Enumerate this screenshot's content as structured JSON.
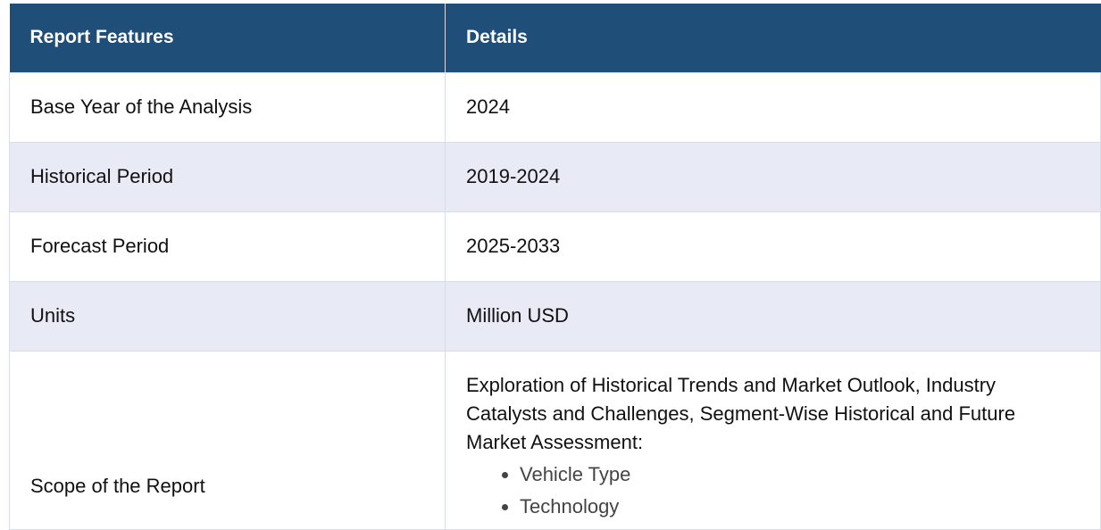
{
  "table": {
    "headers": [
      "Report Features",
      "Details"
    ],
    "rows": [
      {
        "feature": "Base Year of the Analysis",
        "detail": "2024"
      },
      {
        "feature": "Historical Period",
        "detail": "2019-2024"
      },
      {
        "feature": "Forecast Period",
        "detail": "2025-2033"
      },
      {
        "feature": "Units",
        "detail": "Million USD"
      }
    ],
    "scope": {
      "feature": "Scope of the Report",
      "description": "Exploration of Historical Trends and Market Outlook, Industry Catalysts and Challenges, Segment-Wise Historical and Future Market Assessment:",
      "items": [
        "Vehicle Type",
        "Technology"
      ]
    }
  },
  "colors": {
    "header_bg": "#1f4e79",
    "alt_row_bg": "#e8eaf5",
    "border": "#d8dde8"
  }
}
